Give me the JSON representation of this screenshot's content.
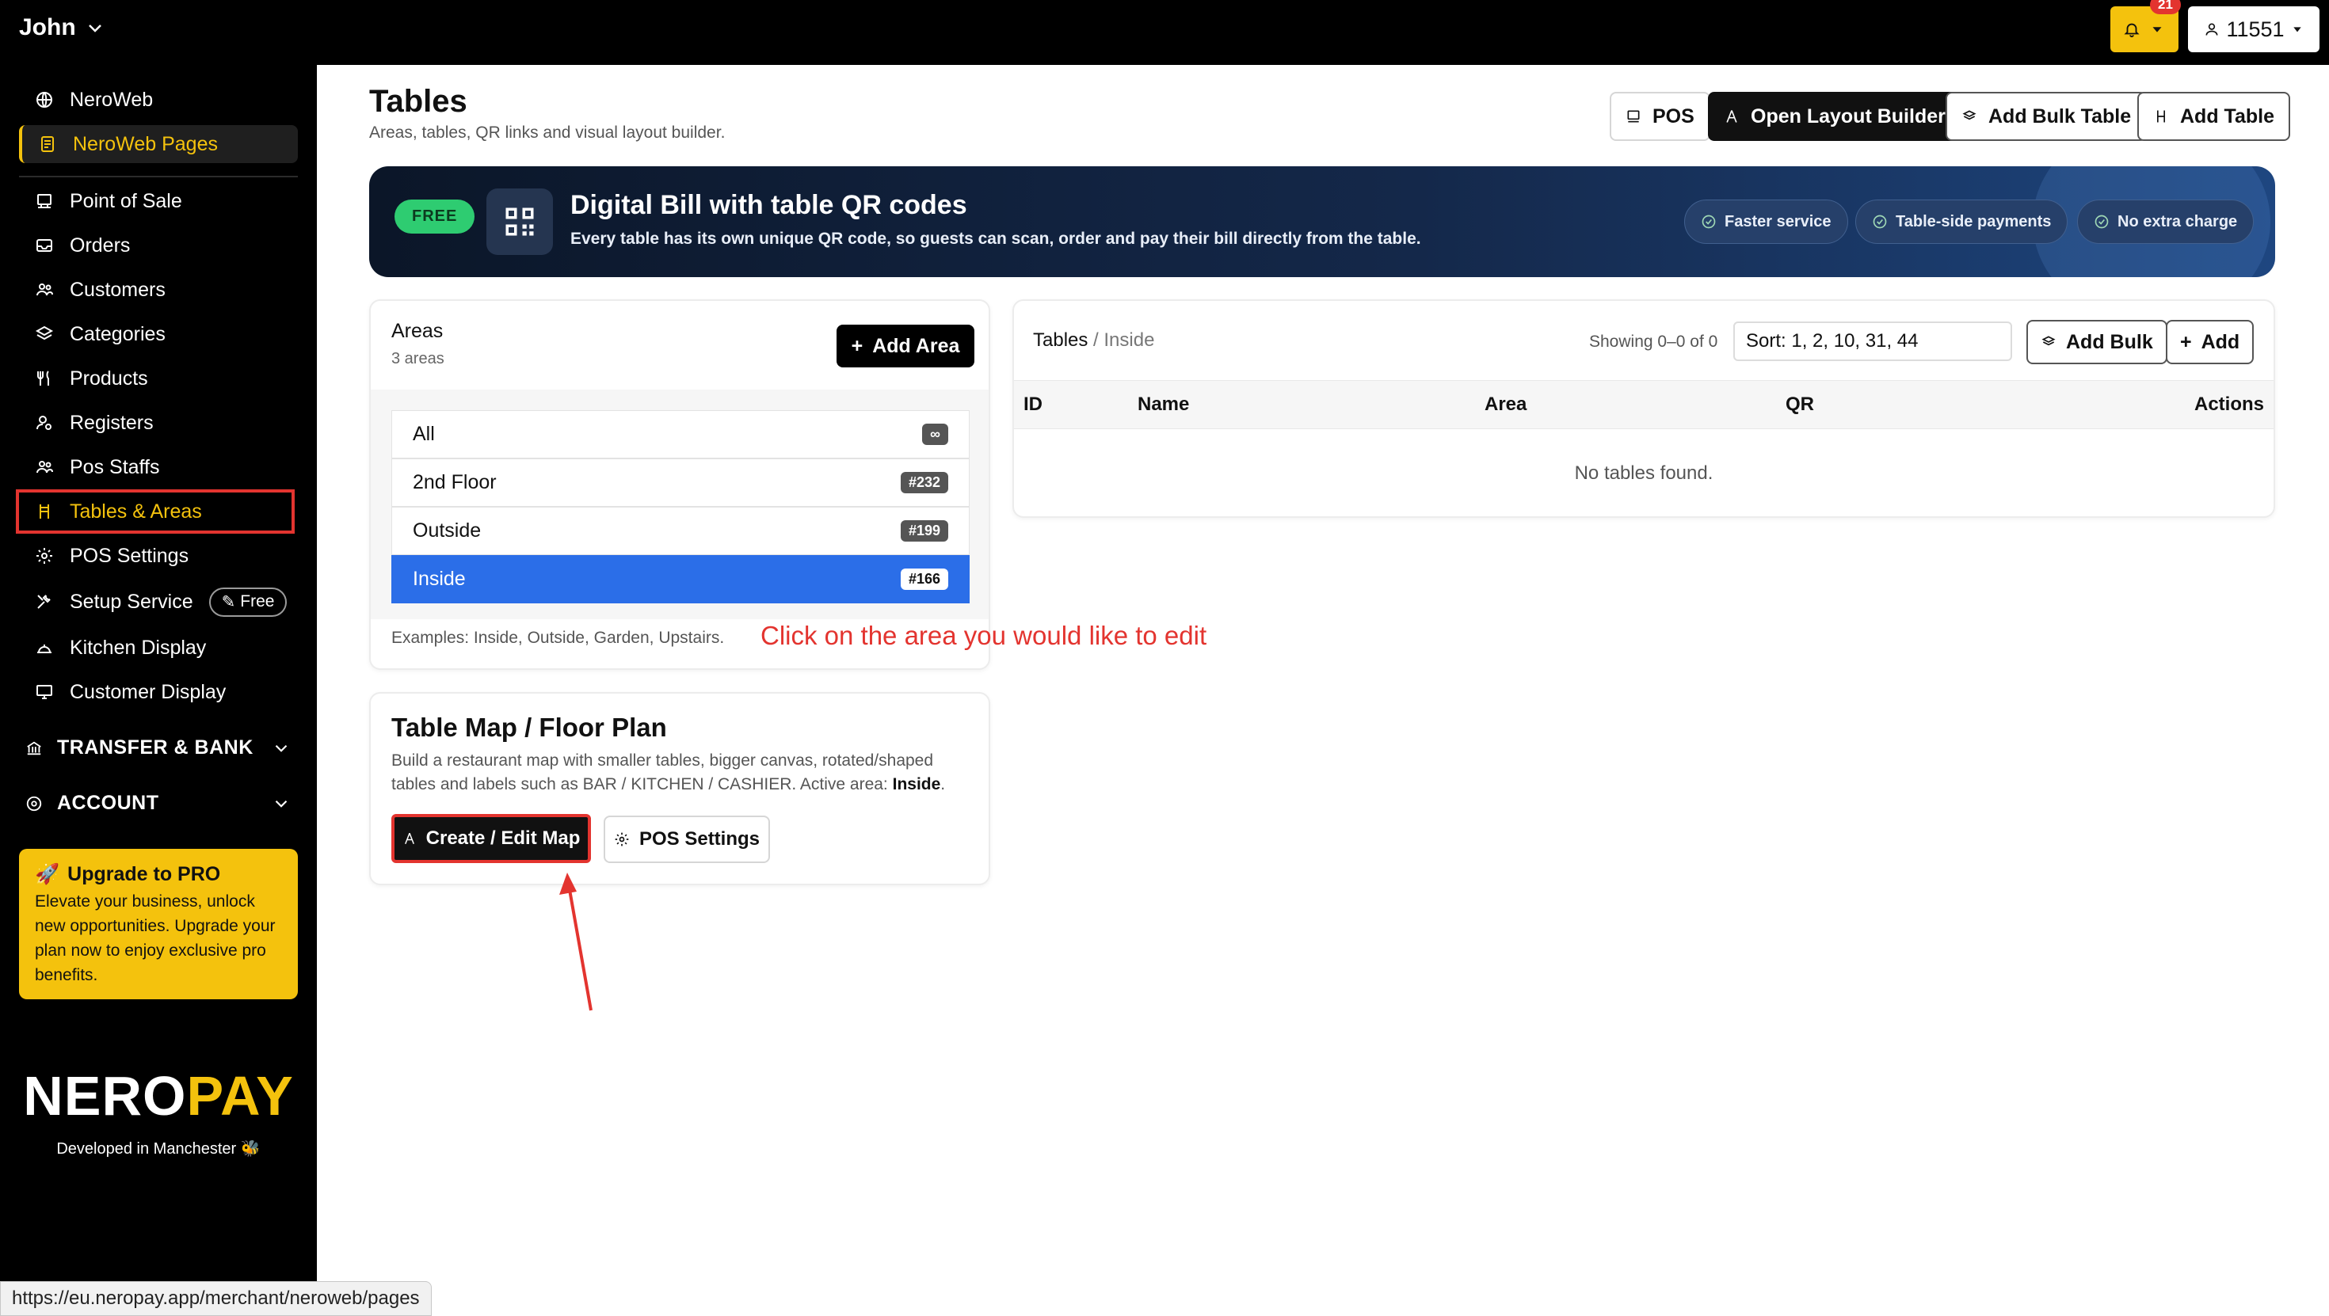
{
  "topbar": {
    "user_name": "John",
    "notification_count": "21",
    "account_label": "11551"
  },
  "sidebar": {
    "items": [
      {
        "label": "NeroWeb",
        "icon": "globe-icon"
      },
      {
        "label": "NeroWeb Pages",
        "icon": "page-icon"
      },
      {
        "label": "Point of Sale",
        "icon": "pos-icon"
      },
      {
        "label": "Orders",
        "icon": "inbox-icon"
      },
      {
        "label": "Customers",
        "icon": "users-icon"
      },
      {
        "label": "Categories",
        "icon": "layers-icon"
      },
      {
        "label": "Products",
        "icon": "utensils-icon"
      },
      {
        "label": "Registers",
        "icon": "user-cog-icon"
      },
      {
        "label": "Pos Staffs",
        "icon": "users-icon"
      },
      {
        "label": "Tables & Areas",
        "icon": "chair-icon"
      },
      {
        "label": "POS Settings",
        "icon": "gear-icon"
      },
      {
        "label": "Setup Service",
        "icon": "tools-icon",
        "pill": "Free"
      },
      {
        "label": "Kitchen Display",
        "icon": "kitchen-icon"
      },
      {
        "label": "Customer Display",
        "icon": "monitor-icon"
      }
    ],
    "sections": [
      {
        "label": "TRANSFER & BANK"
      },
      {
        "label": "ACCOUNT"
      }
    ],
    "upgrade": {
      "title": "Upgrade to PRO",
      "text": "Elevate your business, unlock new opportunities. Upgrade your plan now to enjoy exclusive pro benefits."
    },
    "logo_white": "NERO",
    "logo_yellow": "PAY",
    "developed": "Developed in Manchester"
  },
  "header": {
    "title": "Tables",
    "subtitle": "Areas, tables, QR links and visual layout builder.",
    "buttons": {
      "pos": "POS",
      "layout_builder": "Open Layout Builder",
      "bulk_table": "Add Bulk Table",
      "add_table": "Add Table"
    }
  },
  "banner": {
    "badge": "FREE",
    "title": "Digital Bill with table QR codes",
    "text": "Every table has its own unique QR code, so guests can scan, order and pay their bill directly from the table.",
    "chips": [
      "Faster service",
      "Table-side payments",
      "No extra charge"
    ]
  },
  "areas": {
    "title": "Areas",
    "count": "3 areas",
    "add_button": "Add Area",
    "rows": [
      {
        "name": "All",
        "badge": "∞"
      },
      {
        "name": "2nd Floor",
        "badge": "#232"
      },
      {
        "name": "Outside",
        "badge": "#199"
      },
      {
        "name": "Inside",
        "badge": "#166"
      }
    ],
    "examples": "Examples: Inside, Outside, Garden, Upstairs."
  },
  "annotation": "Click on the area you would like to edit",
  "tables": {
    "crumb_root": "Tables",
    "crumb_sep": "/",
    "crumb_area": "Inside",
    "showing": "Showing 0–0 of 0",
    "sort_value": "Sort: 1, 2, 10, 31, 44",
    "add_bulk": "Add Bulk",
    "add": "Add",
    "columns": [
      "ID",
      "Name",
      "Area",
      "QR",
      "Actions"
    ],
    "empty": "No tables found."
  },
  "table_map": {
    "title": "Table Map / Floor Plan",
    "desc": "Build a restaurant map with smaller tables, bigger canvas, rotated/shaped tables and labels such as BAR / KITCHEN / CASHIER. Active area:",
    "active_area": "Inside",
    "create_button": "Create / Edit Map",
    "pos_settings_button": "POS Settings"
  },
  "statusbar": {
    "url": "https://eu.neropay.app/merchant/neroweb/pages"
  },
  "colors": {
    "accent_yellow": "#f4c20d",
    "selected_blue": "#2b6ee8",
    "annotation_red": "#e3342f"
  }
}
